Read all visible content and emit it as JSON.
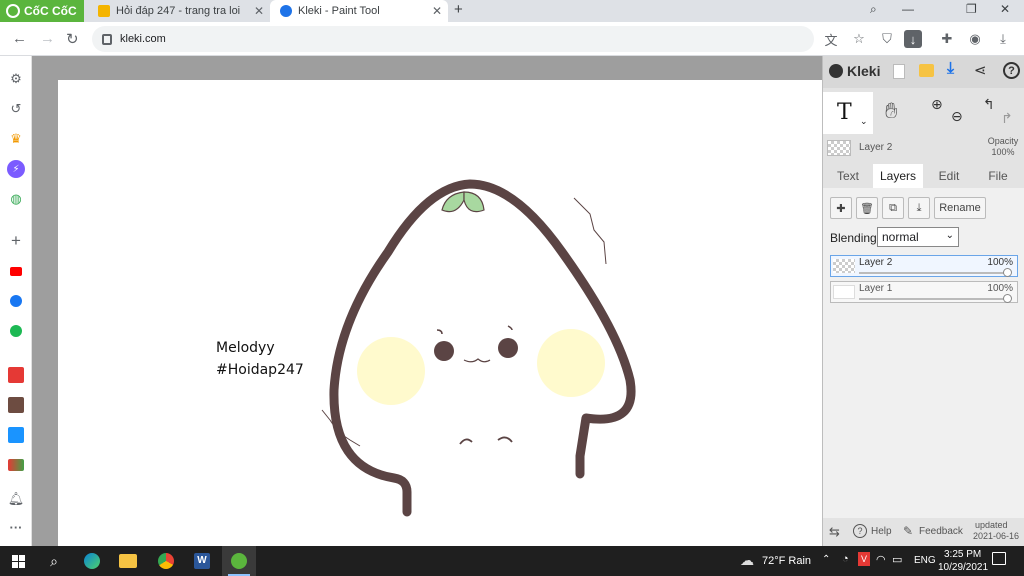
{
  "browser": {
    "brand": "CốC CốC",
    "tabs": [
      {
        "title": "Hỏi đáp 247 - trang tra loi",
        "active": false
      },
      {
        "title": "Kleki - Paint Tool",
        "active": true
      }
    ],
    "new_tab": "+",
    "url": "kleki.com"
  },
  "canvas": {
    "text_line1": "Melodyy",
    "text_line2": "#Hoidap247"
  },
  "kleki": {
    "title": "Kleki",
    "active_tool_label": "T",
    "current_layer": "Layer 2",
    "opacity_label": "Opacity",
    "opacity_value": "100%",
    "tabs": [
      "Text",
      "Layers",
      "Edit",
      "File"
    ],
    "active_tab": "Layers",
    "rename_label": "Rename",
    "blending_label": "Blending",
    "blending_value": "normal",
    "layers": [
      {
        "name": "Layer 2",
        "opacity": "100%",
        "selected": true
      },
      {
        "name": "Layer 1",
        "opacity": "100%",
        "selected": false
      }
    ],
    "help_label": "Help",
    "feedback_label": "Feedback",
    "updated_label": "updated",
    "updated_date": "2021-06-16"
  },
  "taskbar": {
    "weather": "72°F  Rain",
    "language": "ENG",
    "time": "3:25 PM",
    "date": "10/29/2021"
  },
  "colors": {
    "brand_green": "#5bb53d",
    "outline": "#5b4444",
    "cheek": "#fffacd",
    "leaf": "#a8d8a0",
    "taskbar": "#1f1f1f"
  }
}
